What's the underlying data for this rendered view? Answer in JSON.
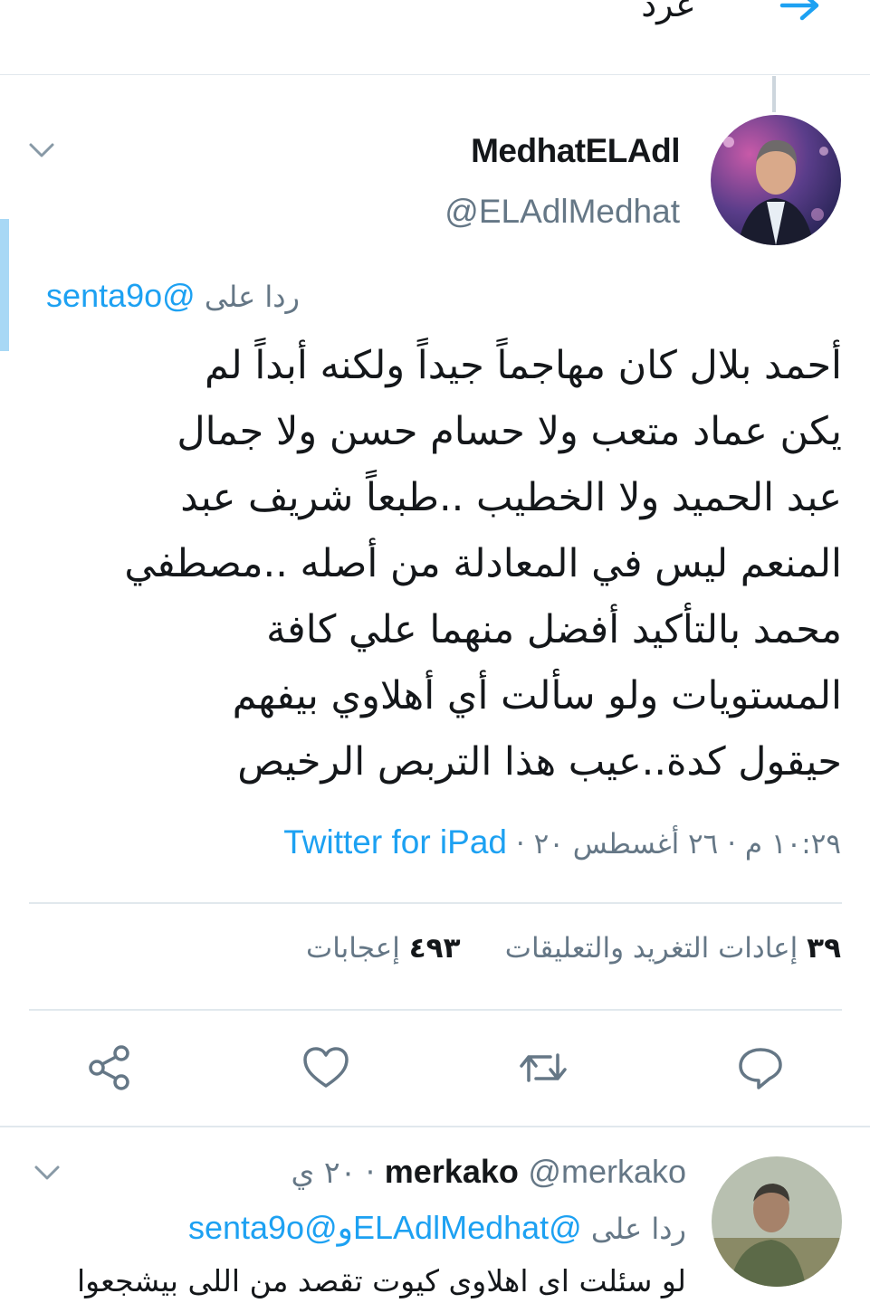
{
  "header": {
    "title": "غرد",
    "back_icon": "arrow-right-icon"
  },
  "tweet": {
    "display_name": "MedhatELAdl",
    "handle": "@ELAdlMedhat",
    "reply_label": "ردا على",
    "reply_to": "@senta9o",
    "lines": [
      "أحمد بلال كان مهاجماً جيداً ولكنه أبداً لم",
      "يكن عماد متعب ولا حسام حسن ولا جمال",
      "عبد الحميد ولا الخطيب ..طبعاً شريف عبد",
      "المنعم ليس في المعادلة من أصله ..مصطفي",
      "محمد بالتأكيد أفضل منهما علي كافة",
      "المستويات ولو سألت أي أهلاوي بيفهم",
      "حيقول كدة..عيب هذا التربص الرخيص"
    ],
    "timestamp": "١٠:٢٩ م · ٢٦ أغسطس ٢٠ ·",
    "source": "Twitter for iPad",
    "retweets_count": "٣٩",
    "retweets_label": "إعادات التغريد والتعليقات",
    "likes_count": "٤٩٣",
    "likes_label": "إعجابات",
    "actions": [
      "reply-icon",
      "retweet-icon",
      "like-icon",
      "share-icon"
    ]
  },
  "reply": {
    "display_name": "merkako",
    "handle": "@merkako",
    "time": "· ٢٠ ي",
    "reply_label": "ردا على",
    "reply_to_1": "@ELAdlMedhat",
    "conj": "و",
    "reply_to_2": "@senta9o",
    "text": "لو سئلت اى اهلاوى كيوت تقصد من اللى بيشجعوا"
  },
  "colors": {
    "accent": "#1da1f2",
    "muted": "#657786",
    "text": "#14171a",
    "divider": "#e1e8ed"
  }
}
